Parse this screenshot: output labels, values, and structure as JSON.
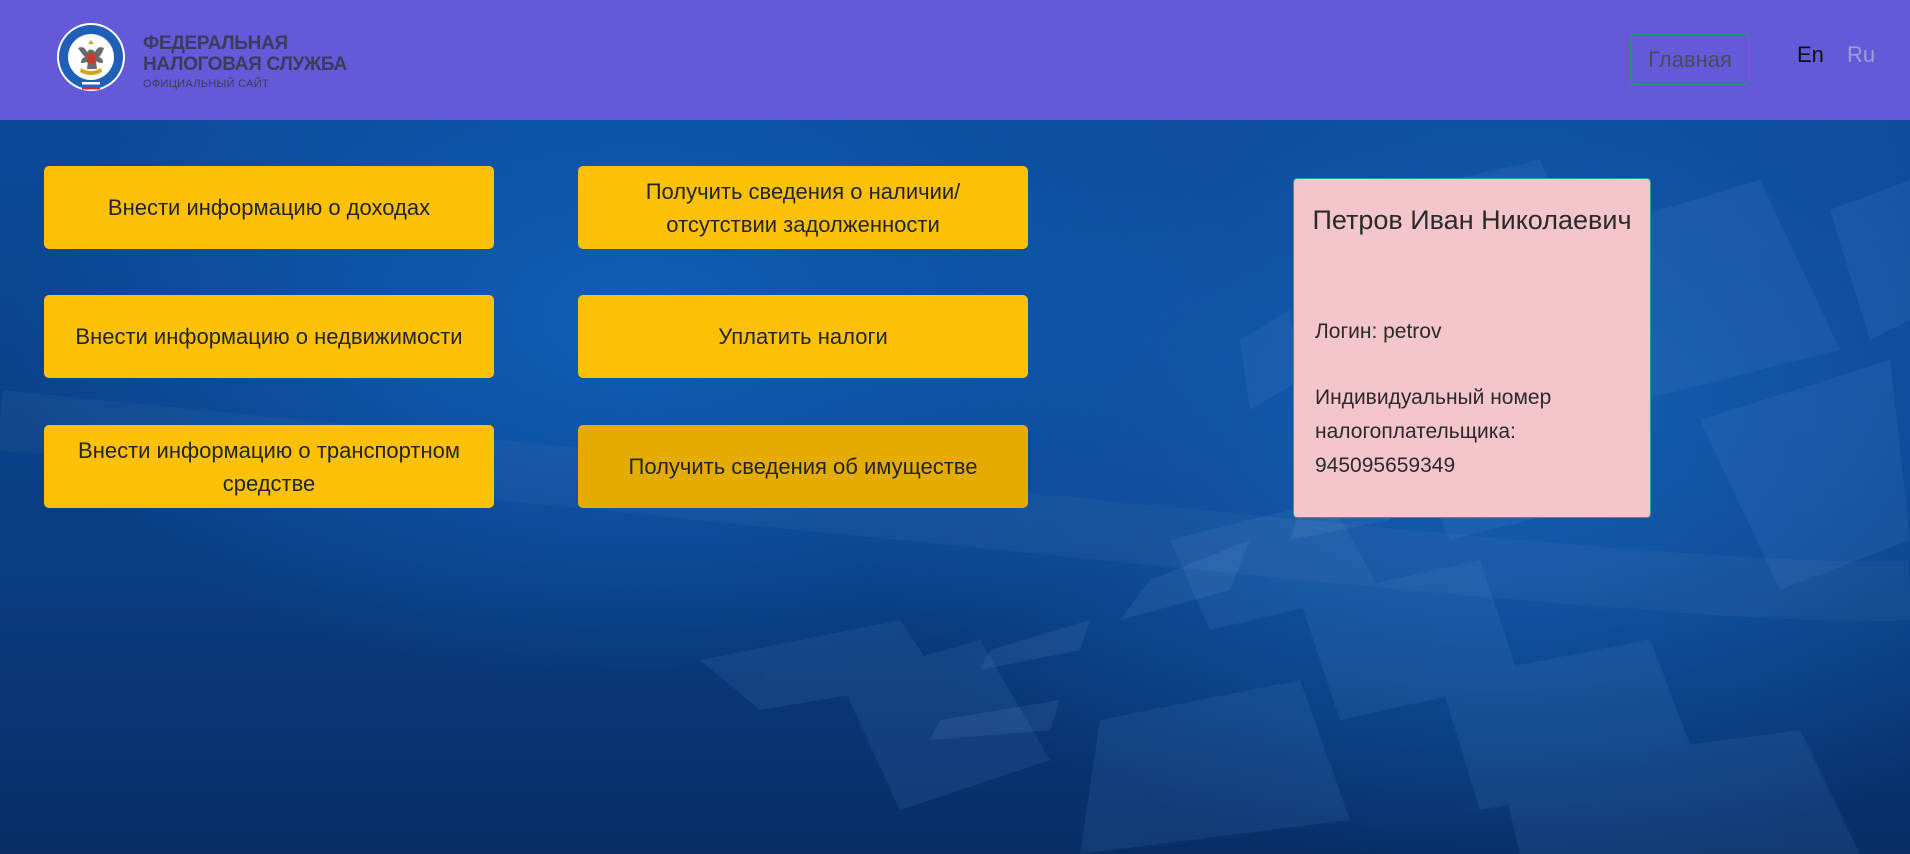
{
  "header": {
    "brand_line1": "ФЕДЕРАЛЬНАЯ",
    "brand_line2": "НАЛОГОВАЯ СЛУЖБА",
    "brand_line3": "ОФИЦИАЛЬНЫЙ САЙТ",
    "logo_icon": "fns-emblem-icon",
    "logo_ring_text": "ФЕДЕРАЛЬНАЯ НАЛОГОВАЯ СЛУЖБА",
    "home_label": "Главная",
    "lang_en": "En",
    "lang_ru": "Ru",
    "bg_color": "#6359d9"
  },
  "actions": {
    "income": "Внести информацию о доходах",
    "realty": "Внести информацию о недвижимости",
    "vehicle": "Внести информацию о транспортном средстве",
    "debt": "Получить сведения о наличии/ отсутствии задолженности",
    "pay": "Уплатить налоги",
    "property": "Получить сведения об имуществе",
    "button_color": "#ffc107",
    "button_active_color": "#e4ac00"
  },
  "profile": {
    "name": "Петров Иван Николаевич",
    "login": "Логин: petrov",
    "inn": "Индивидуальный номер налогоплательщика: 945095659349",
    "card_color": "#f5c5cc"
  }
}
